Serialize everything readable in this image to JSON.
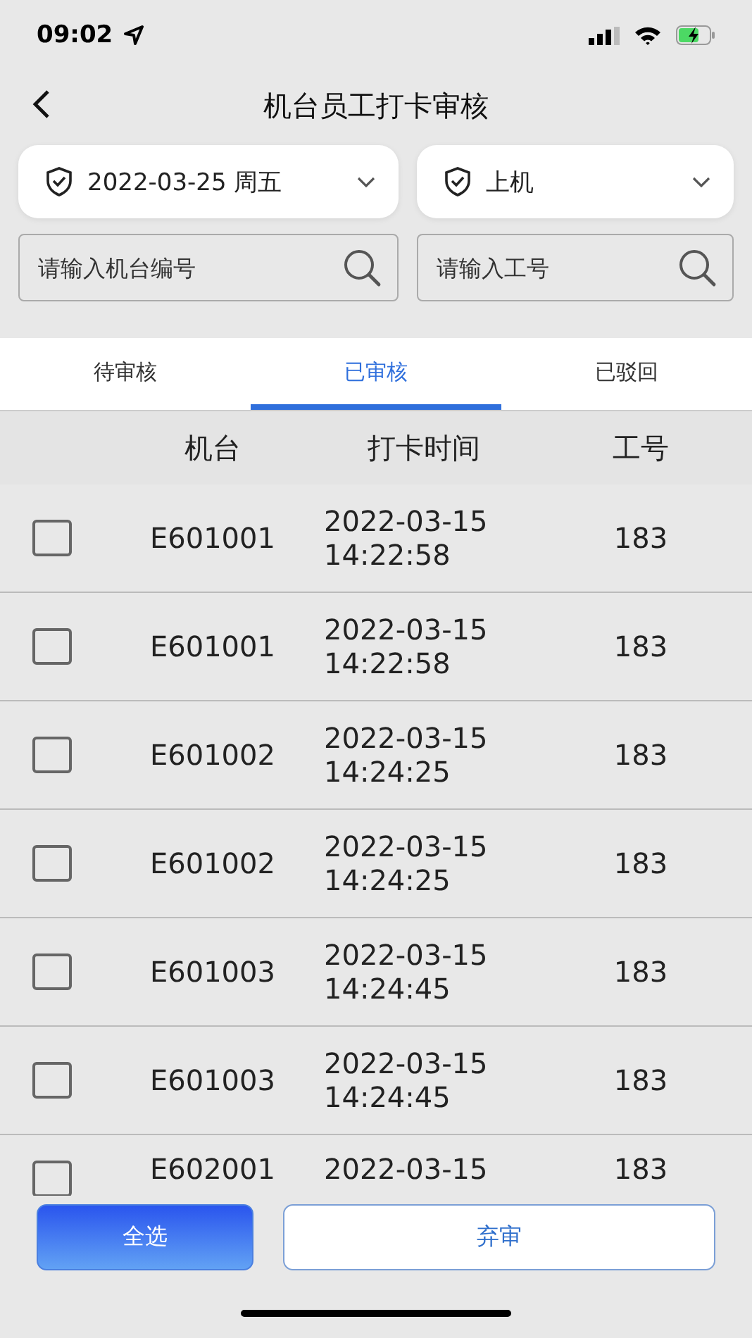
{
  "status_bar": {
    "time": "09:02"
  },
  "header": {
    "title": "机台员工打卡审核"
  },
  "filters": [
    {
      "value": "2022-03-25 周五"
    },
    {
      "value": "上机"
    }
  ],
  "searches": [
    {
      "placeholder": "请输入机台编号"
    },
    {
      "placeholder": "请输入工号"
    }
  ],
  "tabs": [
    {
      "label": "待审核",
      "selected": false
    },
    {
      "label": "已审核",
      "selected": true
    },
    {
      "label": "已驳回",
      "selected": false
    }
  ],
  "table": {
    "columns": [
      "机台",
      "打卡时间",
      "工号"
    ],
    "rows": [
      {
        "checked": false,
        "machine": "E601001",
        "date": "2022-03-15",
        "clock": "14:22:58",
        "employee": "183"
      },
      {
        "checked": false,
        "machine": "E601001",
        "date": "2022-03-15",
        "clock": "14:22:58",
        "employee": "183"
      },
      {
        "checked": false,
        "machine": "E601002",
        "date": "2022-03-15",
        "clock": "14:24:25",
        "employee": "183"
      },
      {
        "checked": false,
        "machine": "E601002",
        "date": "2022-03-15",
        "clock": "14:24:25",
        "employee": "183"
      },
      {
        "checked": false,
        "machine": "E601003",
        "date": "2022-03-15",
        "clock": "14:24:45",
        "employee": "183"
      },
      {
        "checked": false,
        "machine": "E601003",
        "date": "2022-03-15",
        "clock": "14:24:45",
        "employee": "183"
      },
      {
        "checked": false,
        "machine": "E602001",
        "date": "2022-03-15",
        "employee": "183"
      }
    ]
  },
  "buttons": [
    {
      "label": "全选",
      "kind": "primary"
    },
    {
      "label": "弃审",
      "kind": "outline"
    }
  ]
}
